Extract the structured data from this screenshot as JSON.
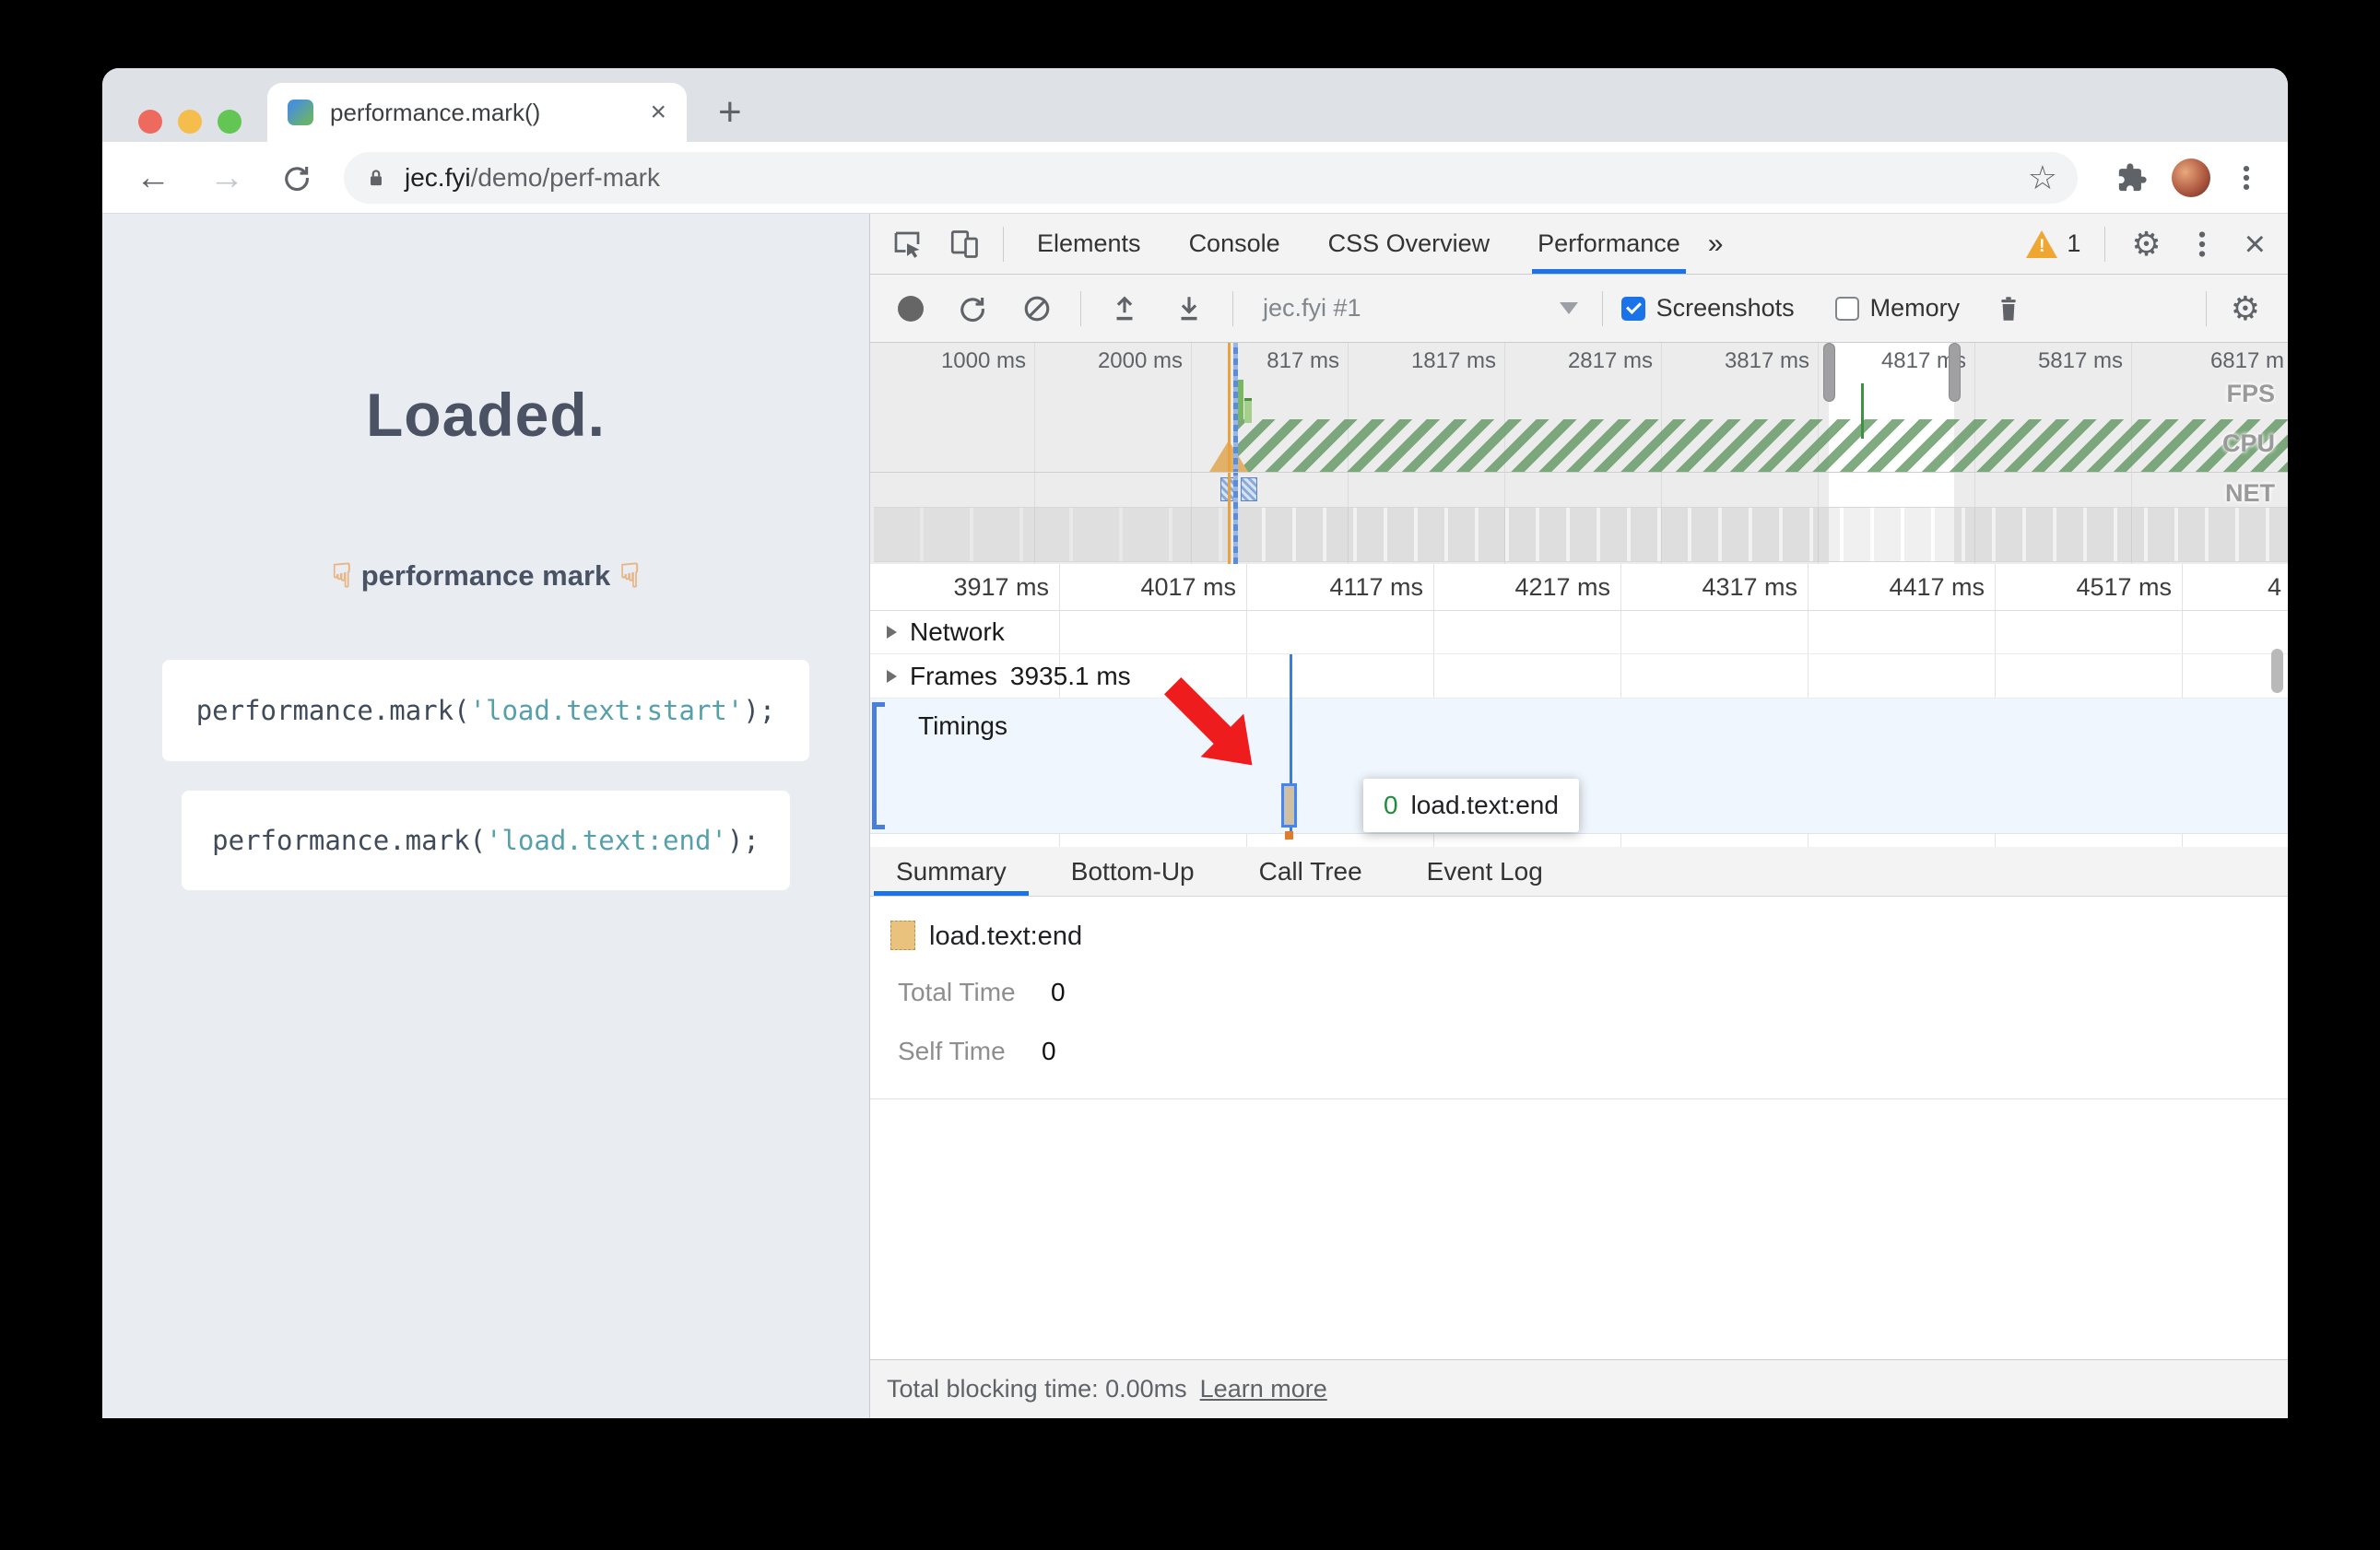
{
  "icons": {
    "tab_close": "×",
    "new_tab": "+",
    "back": "←",
    "forward": "→",
    "star": "☆",
    "more_tabs": "»",
    "warning_mark": "!",
    "gear": "⚙",
    "devtools_close": "×"
  },
  "browser": {
    "tab_title": "performance.mark()",
    "url_domain": "jec.fyi",
    "url_path": "/demo/perf-mark"
  },
  "page": {
    "heading": "Loaded.",
    "pointer": "☟",
    "subtitle": "performance mark",
    "code1": {
      "prefix": "performance.mark(",
      "string": "'load.text:start'",
      "suffix": ");"
    },
    "code2": {
      "prefix": "performance.mark(",
      "string": "'load.text:end'",
      "suffix": ");"
    }
  },
  "devtools": {
    "tabs": [
      {
        "label": "Elements"
      },
      {
        "label": "Console"
      },
      {
        "label": "CSS Overview"
      },
      {
        "label": "Performance"
      }
    ],
    "warning_count": "1",
    "toolbar": {
      "target": "jec.fyi #1",
      "screenshots": "Screenshots",
      "memory": "Memory"
    },
    "overview": {
      "ruler": [
        "1000 ms",
        "2000 ms",
        "817 ms",
        "1817 ms",
        "2817 ms",
        "3817 ms",
        "4817 ms",
        "5817 ms",
        "6817 m"
      ],
      "lanes": [
        "FPS",
        "CPU",
        "NET"
      ]
    },
    "waterfall": {
      "ruler": [
        "3917 ms",
        "4017 ms",
        "4117 ms",
        "4217 ms",
        "4317 ms",
        "4417 ms",
        "4517 ms",
        "4"
      ],
      "network_label": "Network",
      "frames_label": "Frames",
      "frames_value": "3935.1 ms",
      "timings_label": "Timings",
      "tooltip": {
        "value": "0",
        "label": "load.text:end"
      }
    },
    "bottom_tabs": [
      {
        "label": "Summary"
      },
      {
        "label": "Bottom-Up"
      },
      {
        "label": "Call Tree"
      },
      {
        "label": "Event Log"
      }
    ],
    "summary": {
      "title": "load.text:end",
      "total_time_label": "Total Time",
      "total_time": "0",
      "self_time_label": "Self Time",
      "self_time": "0"
    },
    "statusbar": {
      "text": "Total blocking time: 0.00ms",
      "link": "Learn more"
    }
  },
  "colors": {
    "accent": "#1a73e8",
    "timings_row": "#f0f6fd",
    "summary_swatch": "#e9c27e",
    "arrow": "#ee1c1c",
    "cpu_hatch": "#6ba26b",
    "selection_handle": "#9e9ea2"
  }
}
